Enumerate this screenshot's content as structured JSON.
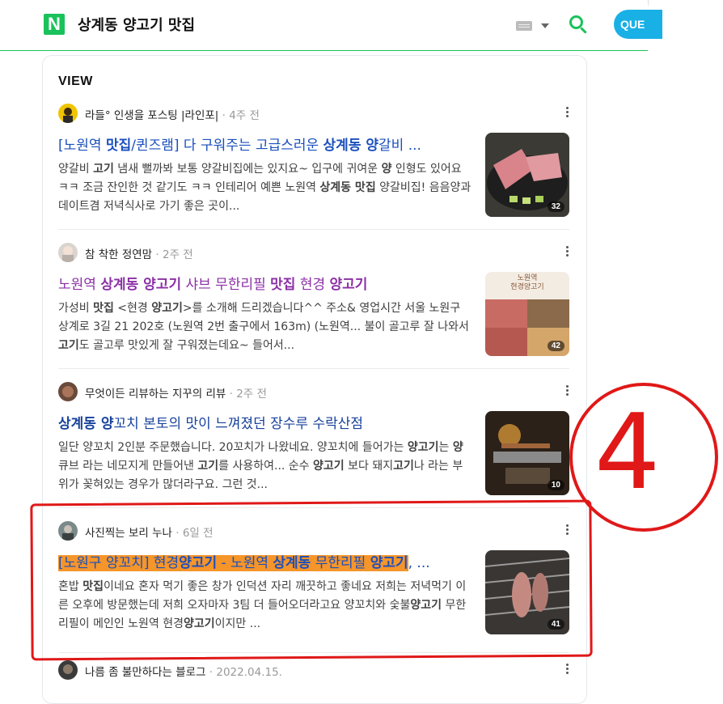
{
  "header": {
    "logo": "N",
    "query": "상계동 양고기 맛집",
    "search_button": "Q"
  },
  "view": {
    "section_title": "VIEW",
    "items": [
      {
        "author": "라들° 인생을 포스팅 |라인포|",
        "time": "4주 전",
        "title_parts": [
          "[노원역 ",
          "맛집",
          "/퀸즈램] 다 구워주는 고급스러운 ",
          "상계동 양",
          "갈비 ..."
        ],
        "snippet_parts": [
          "양갈비 ",
          "고기",
          " 냄새 뻘까봐 보통 양갈비집에는 있지요~ 입구에 귀여운 ",
          "양",
          " 인형도 있어요 ㅋㅋ 조금 잔인한 것 같기도 ㅋㅋ 인테리어 예쁜 노원역 ",
          "상계동 맛집",
          " 양갈비집! 음음양과 데이트겸 저녁식사로 가기 좋은 곳이..."
        ],
        "photo_count": "32"
      },
      {
        "author": "참 착한 정연맘",
        "time": "2주 전",
        "title_parts": [
          "노원역 ",
          "상계동 양고기",
          " 샤브 무한리필 ",
          "맛집",
          " 현경 ",
          "양고기"
        ],
        "snippet_parts": [
          "가성비 ",
          "맛집",
          " <현경 ",
          "양고기",
          ">를 소개해 드리겠습니다^^ 주소& 영업시간 서울 노원구 상계로 3길 21 202호 (노원역 2번 출구에서 163m) (노원역... 불이 골고루 잘 나와서 ",
          "고기",
          "도 골고루 맛있게 잘 구워졌는데요~ 들어서..."
        ],
        "thumb_caption": "노원역\n현경양고기",
        "photo_count": "42"
      },
      {
        "author": "무엇이든 리뷰하는 지꾸의 리뷰",
        "time": "2주 전",
        "title_parts": [
          "상계동 양",
          "꼬치 본토의 맛이 느껴졌던 장수루 수락산점"
        ],
        "snippet_parts": [
          "일단 양꼬치 2인분 주문했습니다. 20꼬치가 나왔네요. 양꼬치에 들어가는 ",
          "양고기",
          "는 ",
          "양",
          " 큐브 라는 네모지게 만들어낸 ",
          "고기",
          "를 사용하여... 순수 ",
          "양고기",
          " 보다 돼지",
          "고기",
          "나 라는 부위가 꽂혀있는 경우가 많더라구요. 그런 것..."
        ],
        "photo_count": "10"
      },
      {
        "author": "사진찍는 보리 누나",
        "time": "6일 전",
        "title_parts": [
          "[노원구 양꼬치] 현경",
          "양고기",
          " - 노원역 ",
          "상계동",
          " 무한리필 ",
          "양고기",
          ", ..."
        ],
        "snippet_parts": [
          "혼밥 ",
          "맛집",
          "이네요 혼자 먹기 좋은 창가 인덕션 자리 깨끗하고 좋네요 저희는 저녁먹기 이른 오후에 방문했는데 저희 오자마자 3팀 더 들어오더라고요 양꼬치와 숯불",
          "양고기",
          " 무한리필이 메인인 노원역 현경",
          "양고기",
          "이지만 ..."
        ],
        "photo_count": "41"
      },
      {
        "author": "나름 좀 불만하다는 블로그",
        "time": "2022.04.15."
      }
    ]
  },
  "annotation": {
    "number": "4",
    "color": "#e01818"
  },
  "colors": {
    "brand_green": "#19c25a",
    "link_blue": "#1a4fbd",
    "visited_purple": "#8b2fa6",
    "highlight_orange": "#f5952a"
  }
}
